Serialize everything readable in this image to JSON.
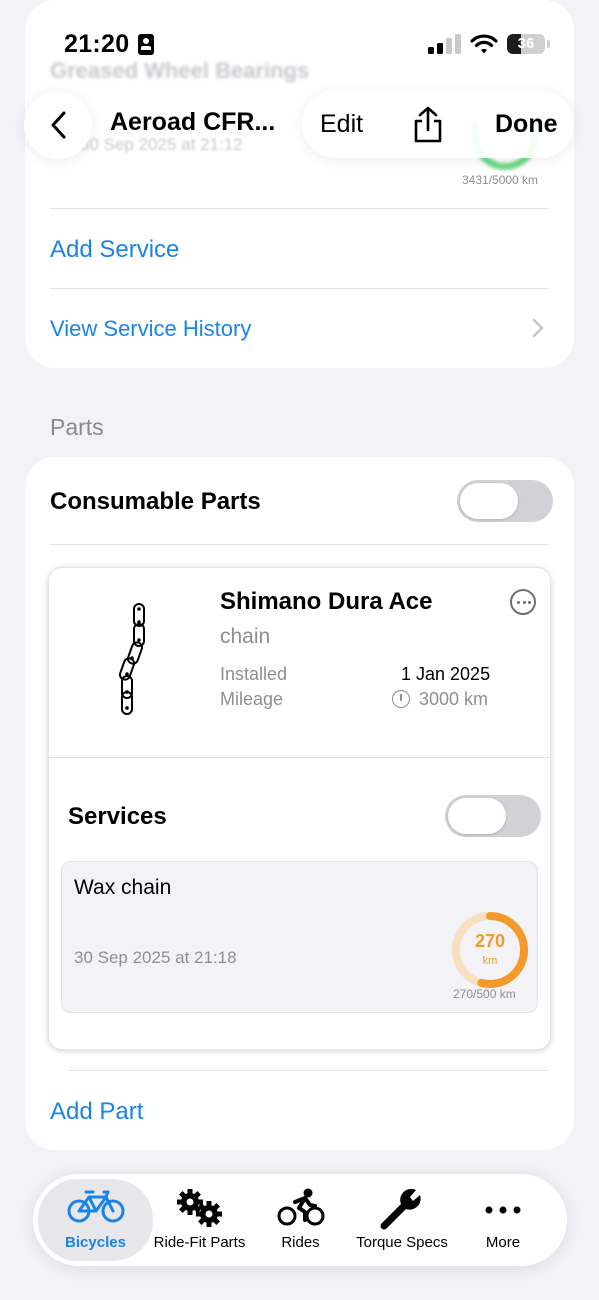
{
  "status_bar": {
    "time": "21:20",
    "battery": "36"
  },
  "ghost": {
    "title": "Greased Wheel Bearings",
    "date": "30 Sep 2025 at 21:12",
    "mileage": "3431/5000 km"
  },
  "nav": {
    "title": "Aeroad CFR...",
    "edit": "Edit",
    "done": "Done"
  },
  "service_card": {
    "add_service": "Add Service",
    "view_history": "View Service History"
  },
  "parts": {
    "section_title": "Parts",
    "consumable_label": "Consumable Parts",
    "consumable_on": false,
    "part": {
      "name": "Shimano Dura Ace",
      "type": "chain",
      "installed_label": "Installed",
      "installed_value": "1 Jan 2025",
      "mileage_label": "Mileage",
      "mileage_value": "3000 km",
      "icon": "chain-icon"
    },
    "services_label": "Services",
    "services_on": false,
    "service": {
      "name": "Wax chain",
      "date": "30 Sep 2025 at 21:18",
      "ring_value": "270",
      "ring_unit": "km",
      "ring_caption": "270/500 km",
      "progress": 0.54,
      "color": "#f39a2b"
    },
    "add_part": "Add Part"
  },
  "tabs": [
    {
      "label": "Bicycles",
      "icon": "bicycle-icon",
      "active": true
    },
    {
      "label": "Ride-Fit Parts",
      "icon": "gears-icon",
      "active": false
    },
    {
      "label": "Rides",
      "icon": "cyclist-icon",
      "active": false
    },
    {
      "label": "Torque Specs",
      "icon": "wrench-icon",
      "active": false
    },
    {
      "label": "More",
      "icon": "ellipsis-icon",
      "active": false
    }
  ],
  "colors": {
    "accent": "#1a84e6",
    "ring": "#f39a2b",
    "ring_green": "#34c759"
  }
}
